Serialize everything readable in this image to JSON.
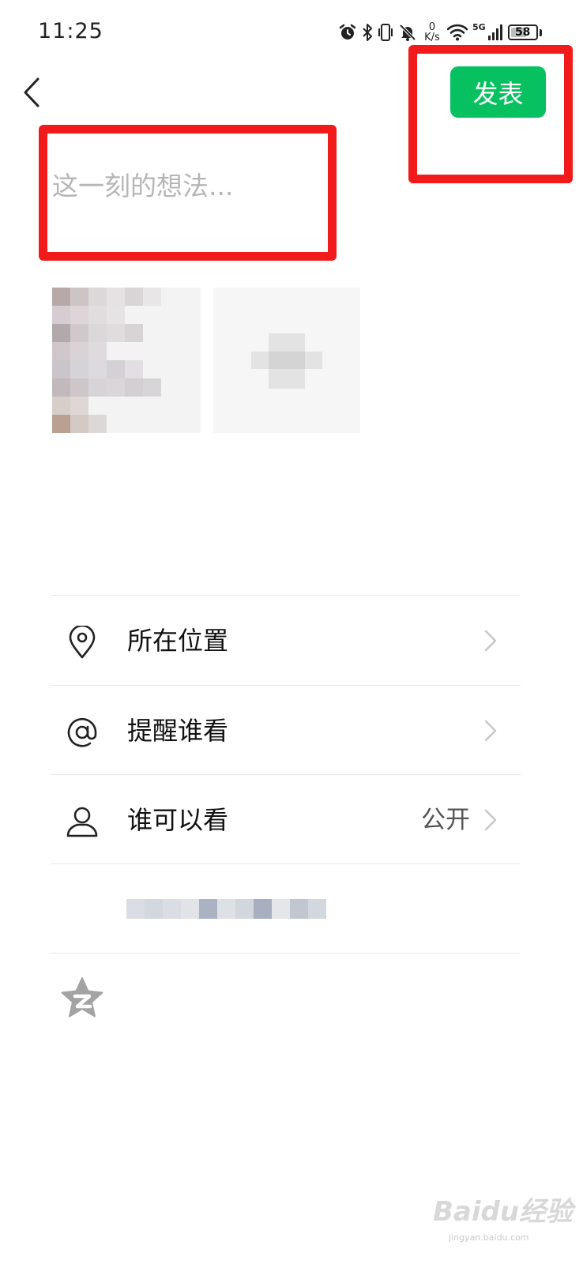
{
  "status_bar": {
    "time": "11:25",
    "net_speed_value": "0",
    "net_speed_unit": "K/s",
    "network_type": "5G",
    "battery_level": "58",
    "icons": [
      "alarm-icon",
      "bluetooth-icon",
      "vibrate-icon",
      "mute-icon",
      "wifi-icon",
      "signal-icon",
      "battery-icon"
    ]
  },
  "header": {
    "back_icon": "chevron-left-icon",
    "publish_label": "发表",
    "publish_color": "#07c160"
  },
  "composer": {
    "placeholder": "这一刻的想法...",
    "value": ""
  },
  "media": {
    "thumbnail_count": 1,
    "add_icon": "plus-icon"
  },
  "options": [
    {
      "icon": "location-pin-icon",
      "label": "所在位置",
      "value": ""
    },
    {
      "icon": "at-icon",
      "label": "提醒谁看",
      "value": ""
    },
    {
      "icon": "person-icon",
      "label": "谁可以看",
      "value": "公开"
    }
  ],
  "share": {
    "qzone_icon": "qzone-star-icon"
  },
  "annotation_color": "#f11b1b",
  "watermark": {
    "text": "Baidu经验",
    "sub": "jingyan.baidu.com"
  }
}
